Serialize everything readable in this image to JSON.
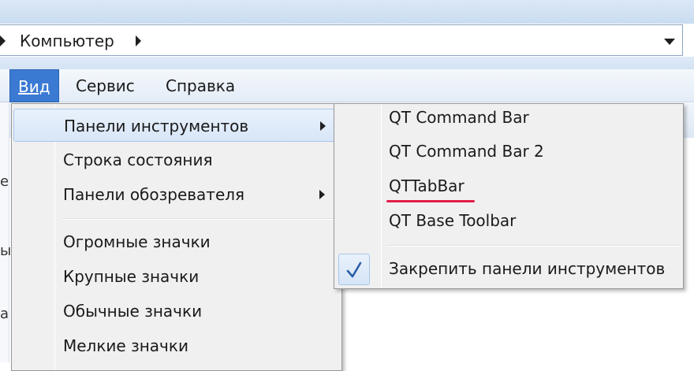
{
  "address_bar": {
    "path": "Компьютер"
  },
  "menubar": {
    "items": [
      {
        "label": "Вид",
        "active": true
      },
      {
        "label": "Сервис",
        "active": false
      },
      {
        "label": "Справка",
        "active": false
      }
    ]
  },
  "left_fragments": [
    "е",
    "ы",
    "а"
  ],
  "view_menu": {
    "items": [
      {
        "label": "Панели инструментов",
        "has_submenu": true,
        "highlighted": true
      },
      {
        "label": "Строка состояния",
        "has_submenu": false
      },
      {
        "label": "Панели обозревателя",
        "has_submenu": true
      },
      {
        "label": "Огромные значки",
        "has_submenu": false
      },
      {
        "label": "Крупные значки",
        "has_submenu": false
      },
      {
        "label": "Обычные значки",
        "has_submenu": false
      },
      {
        "label": "Мелкие значки",
        "has_submenu": false
      }
    ]
  },
  "toolbars_submenu": {
    "items": [
      {
        "label": "QT Command Bar"
      },
      {
        "label": "QT Command Bar 2"
      },
      {
        "label": "QTTabBar",
        "annotated": true
      },
      {
        "label": "QT Base Toolbar"
      },
      {
        "label": "Закрепить панели инструментов",
        "checked": true
      }
    ]
  },
  "colors": {
    "active_menu": "#3b7ad3",
    "annotation_underline": "#e11d48",
    "check_mark": "#2a5ea8"
  },
  "icons": {
    "check": "check-icon",
    "submenu_arrow": "chevron-right-icon",
    "address_dropdown": "chevron-down-icon"
  }
}
